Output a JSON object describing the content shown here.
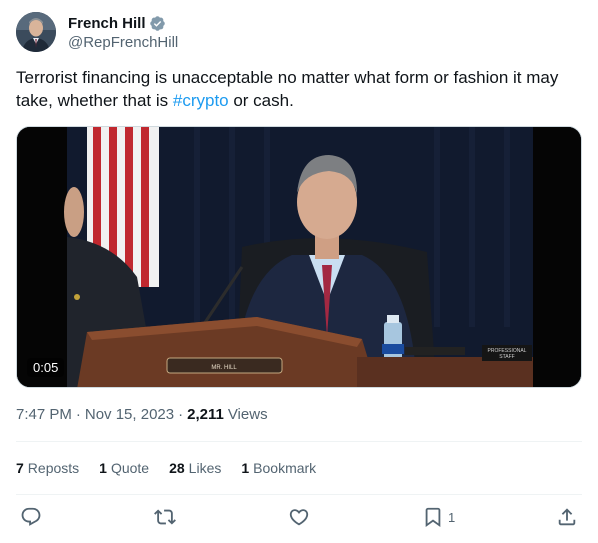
{
  "author": {
    "name": "French Hill",
    "handle": "@RepFrenchHill",
    "verified": true,
    "avatar_icon": "avatar-photo"
  },
  "tweet": {
    "text_before": "Terrorist financing is unacceptable no matter what form or fashion it may take, whether that is ",
    "hashtag": "#crypto",
    "text_after": " or cash."
  },
  "media": {
    "duration": "0:05",
    "nameplate": "MR. HILL",
    "staff_sign_line1": "PROFESSIONAL",
    "staff_sign_line2": "STAFF"
  },
  "meta": {
    "time": "7:47 PM",
    "date": "Nov 15, 2023",
    "views_count": "2,211",
    "views_label": "Views"
  },
  "stats": [
    {
      "count": "7",
      "label": "Reposts"
    },
    {
      "count": "1",
      "label": "Quote"
    },
    {
      "count": "28",
      "label": "Likes"
    },
    {
      "count": "1",
      "label": "Bookmark"
    }
  ],
  "actions": {
    "reply_icon": "reply-icon",
    "repost_icon": "repost-icon",
    "like_icon": "like-icon",
    "bookmark_icon": "bookmark-icon",
    "bookmark_count": "1",
    "share_icon": "share-icon"
  },
  "colors": {
    "accent": "#1d9bf0",
    "muted": "#536471",
    "text": "#0f1419"
  }
}
